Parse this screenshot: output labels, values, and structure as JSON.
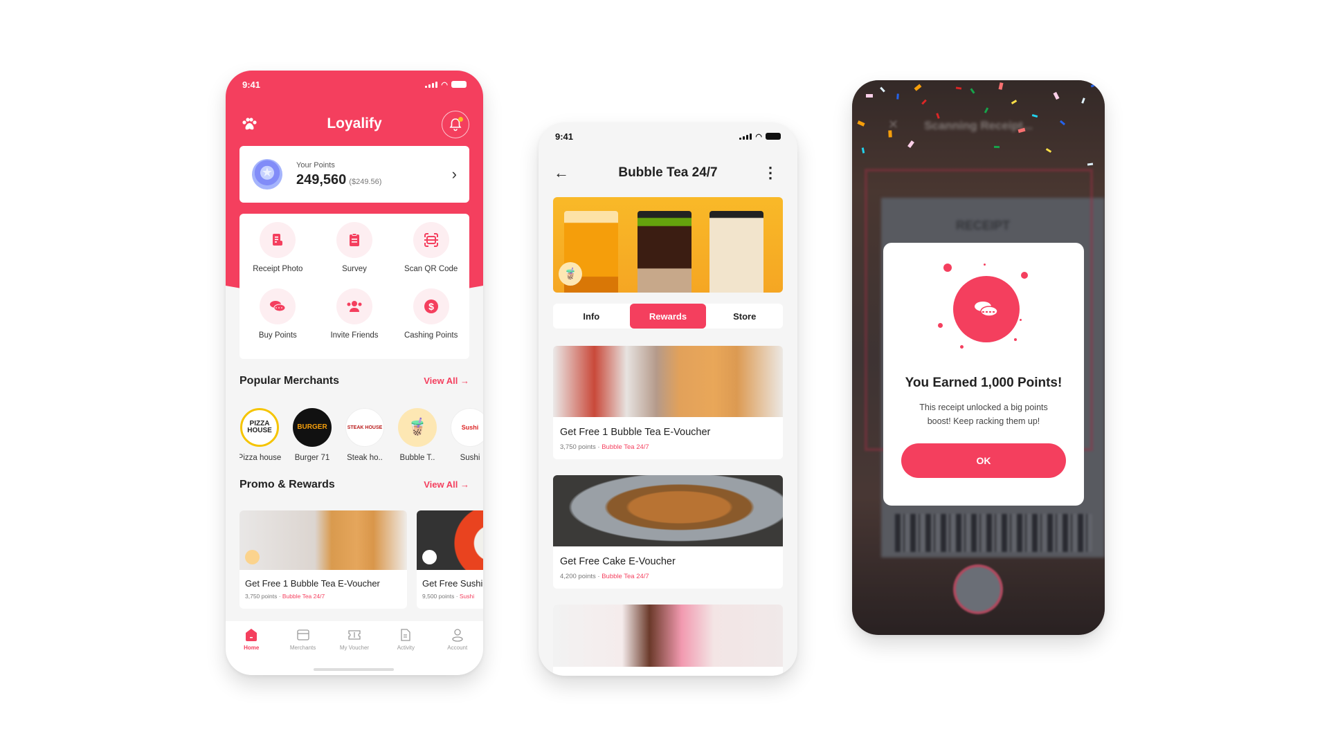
{
  "brand_color": "#f43f5e",
  "home_screen": {
    "status_time": "9:41",
    "app_title": "Loyalify",
    "logo_icon": "paw-icon",
    "notification_icon": "bell-icon",
    "points_card": {
      "label": "Your Points",
      "value": "249,560",
      "cash_value": "($249.56)"
    },
    "actions": [
      {
        "label": "Receipt Photo",
        "icon": "receipt-icon"
      },
      {
        "label": "Survey",
        "icon": "clipboard-icon"
      },
      {
        "label": "Scan QR Code",
        "icon": "scan-icon"
      },
      {
        "label": "Buy Points",
        "icon": "coins-icon"
      },
      {
        "label": "Invite Friends",
        "icon": "users-icon"
      },
      {
        "label": "Cashing Points",
        "icon": "dollar-icon"
      }
    ],
    "popular_merchants": {
      "title": "Popular Merchants",
      "view_all": "View All",
      "items": [
        {
          "name": "Pizza house",
          "logo_text": "PIZZA HOUSE"
        },
        {
          "name": "Burger 71",
          "logo_text": "BURGER"
        },
        {
          "name": "Steak ho..",
          "logo_text": "STEAK HOUSE"
        },
        {
          "name": "Bubble T..",
          "logo_text": "🧋"
        },
        {
          "name": "Sushi",
          "logo_text": "Sushi"
        }
      ]
    },
    "promo_rewards": {
      "title": "Promo & Rewards",
      "view_all": "View All",
      "items": [
        {
          "title": "Get Free 1 Bubble Tea E-Voucher",
          "points": "3,750 points",
          "merchant": "Bubble Tea 24/7"
        },
        {
          "title": "Get Free Sushi",
          "points": "9,500 points",
          "merchant": "Sushi"
        }
      ]
    },
    "tabbar": [
      {
        "label": "Home",
        "icon": "home-icon",
        "active": true
      },
      {
        "label": "Merchants",
        "icon": "store-icon",
        "active": false
      },
      {
        "label": "My Voucher",
        "icon": "ticket-icon",
        "active": false
      },
      {
        "label": "Activity",
        "icon": "document-icon",
        "active": false
      },
      {
        "label": "Account",
        "icon": "user-icon",
        "active": false
      }
    ]
  },
  "merchant_screen": {
    "status_time": "9:41",
    "title": "Bubble Tea 24/7",
    "tabs": [
      {
        "label": "Info",
        "active": false
      },
      {
        "label": "Rewards",
        "active": true
      },
      {
        "label": "Store",
        "active": false
      }
    ],
    "rewards": [
      {
        "title": "Get Free 1 Bubble Tea E-Voucher",
        "points": "3,750 points",
        "merchant": "Bubble Tea 24/7"
      },
      {
        "title": "Get Free Cake E-Voucher",
        "points": "4,200 points",
        "merchant": "Bubble Tea 24/7"
      }
    ]
  },
  "scan_screen": {
    "background_title": "Scanning Receipt...",
    "receipt_label": "RECEIPT",
    "modal": {
      "title": "You Earned 1,000 Points!",
      "message": "This receipt unlocked a big points boost! Keep racking them up!",
      "button": "OK"
    }
  }
}
